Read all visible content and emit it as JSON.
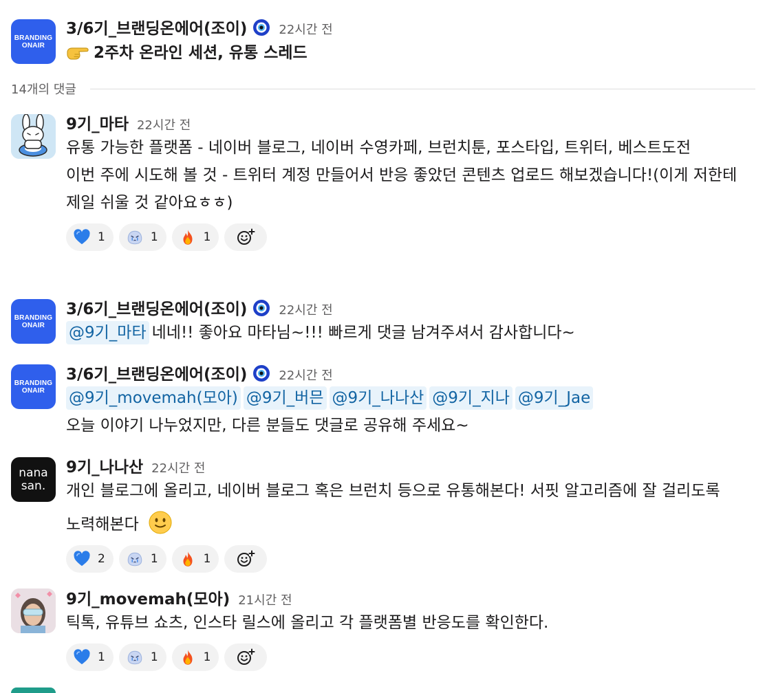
{
  "root": {
    "author": "3/6기_브랜딩온에어(조이)",
    "time": "22시간 전",
    "text": "2주차 온라인 세션, 유통 스레드",
    "avatar_text": [
      "BRANDING",
      "ONAIR"
    ]
  },
  "reply_count": "14개의 댓글",
  "replies": [
    {
      "author": "9기_마타",
      "time": "22시간 전",
      "lines": [
        "유통 가능한 플랫폼 - 네이버 블로그, 네이버 수영카페, 브런치툰, 포스타입, 트위터, 베스트도전",
        "이번 주에 시도해 볼 것 - 트위터 계정 만들어서 반응 좋았던 콘텐츠 업로드 해보겠습니다!(이게 저한테 제일 쉬울 것 같아요ㅎㅎ)"
      ],
      "reactions": [
        {
          "icon": "blue-heart-icon",
          "count": "1"
        },
        {
          "icon": "crying-blob-icon",
          "count": "1"
        },
        {
          "icon": "fire-icon",
          "count": "1"
        }
      ]
    },
    {
      "author": "3/6기_브랜딩온에어(조이)",
      "time": "22시간 전",
      "mentions": [
        "@9기_마타"
      ],
      "text": "네네!! 좋아요 마타님~!!! 빠르게 댓글 남겨주셔서 감사합니다~",
      "avatar_text": [
        "BRANDING",
        "ONAIR"
      ]
    },
    {
      "author": "3/6기_브랜딩온에어(조이)",
      "time": "22시간 전",
      "mentions": [
        "@9기_movemah(모아)",
        "@9기_버믄",
        "@9기_나나산",
        "@9기_지나",
        "@9기_Jae"
      ],
      "text": "오늘 이야기 나누었지만, 다른 분들도 댓글로 공유해 주세요~",
      "avatar_text": [
        "BRANDING",
        "ONAIR"
      ]
    },
    {
      "author": "9기_나나산",
      "time": "22시간 전",
      "text": "개인 블로그에 올리고, 네이버 블로그 혹은 브런치 등으로 유통해본다! 서핏 알고리즘에 잘 걸리도록 노력해본다",
      "avatar_text": [
        "nana",
        "san."
      ],
      "reactions": [
        {
          "icon": "blue-heart-icon",
          "count": "2"
        },
        {
          "icon": "crying-blob-icon",
          "count": "1"
        },
        {
          "icon": "fire-icon",
          "count": "1"
        }
      ]
    },
    {
      "author": "9기_movemah(모아)",
      "time": "21시간 전",
      "text": "틱톡, 유튜브 쇼츠, 인스타 릴스에 올리고 각 플랫폼별 반응도를 확인한다.",
      "reactions": [
        {
          "icon": "blue-heart-icon",
          "count": "1"
        },
        {
          "icon": "crying-blob-icon",
          "count": "1"
        },
        {
          "icon": "fire-icon",
          "count": "1"
        }
      ]
    }
  ],
  "colors": {
    "brand_blue": "#2f5fec",
    "mention_bg": "#e8f3fb",
    "mention_text": "#1264a3",
    "reaction_bg": "#f2f2f2"
  }
}
